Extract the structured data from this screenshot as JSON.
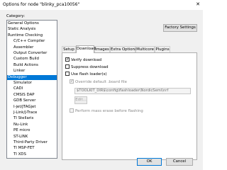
{
  "window": {
    "title": "Options for node \"blinky_pca10056\""
  },
  "category": {
    "label": "Category:",
    "items": [
      {
        "label": "General Options",
        "level": 0,
        "selected": false
      },
      {
        "label": "Static Analysis",
        "level": 0,
        "selected": false
      },
      {
        "label": "Runtime Checking",
        "level": 0,
        "selected": false
      },
      {
        "label": "C/C++ Compiler",
        "level": 1,
        "selected": false
      },
      {
        "label": "Assembler",
        "level": 1,
        "selected": false
      },
      {
        "label": "Output Converter",
        "level": 1,
        "selected": false
      },
      {
        "label": "Custom Build",
        "level": 1,
        "selected": false
      },
      {
        "label": "Build Actions",
        "level": 1,
        "selected": false
      },
      {
        "label": "Linker",
        "level": 1,
        "selected": false
      },
      {
        "label": "Debugger",
        "level": 0,
        "selected": true
      },
      {
        "label": "Simulator",
        "level": 1,
        "selected": false
      },
      {
        "label": "CADI",
        "level": 1,
        "selected": false
      },
      {
        "label": "CMSIS DAP",
        "level": 1,
        "selected": false
      },
      {
        "label": "GDB Server",
        "level": 1,
        "selected": false
      },
      {
        "label": "I-jet/JTAGjet",
        "level": 1,
        "selected": false
      },
      {
        "label": "J-Link/J-Trace",
        "level": 1,
        "selected": false
      },
      {
        "label": "TI Stellaris",
        "level": 1,
        "selected": false
      },
      {
        "label": "Nu-Link",
        "level": 1,
        "selected": false
      },
      {
        "label": "PE micro",
        "level": 1,
        "selected": false
      },
      {
        "label": "ST-LINK",
        "level": 1,
        "selected": false
      },
      {
        "label": "Third-Party Driver",
        "level": 1,
        "selected": false
      },
      {
        "label": "TI MSP-FET",
        "level": 1,
        "selected": false
      },
      {
        "label": "TI XDS",
        "level": 1,
        "selected": false
      }
    ]
  },
  "buttons": {
    "factory_settings": "Factory Settings",
    "ok": "OK",
    "cancel": "Cancel",
    "edit": "Edit..."
  },
  "tabs": [
    {
      "label": "Setup",
      "active": false
    },
    {
      "label": "Download",
      "active": true
    },
    {
      "label": "Images",
      "active": false
    },
    {
      "label": "Extra Options",
      "active": false
    },
    {
      "label": "Multicore",
      "active": false
    },
    {
      "label": "Plugins",
      "active": false
    }
  ],
  "download": {
    "verify_download": {
      "label": "Verify download",
      "checked": true,
      "enabled": true
    },
    "suppress_download": {
      "label": "Suppress download",
      "checked": false,
      "enabled": true
    },
    "use_flash_loaders": {
      "label": "Use flash loader(s)",
      "checked": false,
      "enabled": true
    },
    "override_board_file": {
      "label": "Override default .board file",
      "checked": true,
      "enabled": false
    },
    "board_file_path": "$TOOLKIT_DIR$\\config\\flashloader\\NordicSemi\\nrf",
    "perform_mass_erase": {
      "label": "Perform mass erase before flashing",
      "checked": false,
      "enabled": false
    }
  },
  "icons": {
    "close": "close-icon",
    "check": "checkmark-icon"
  },
  "colors": {
    "selection": "#0078d7",
    "dialog_bg": "#f0f0f0",
    "panel_bg": "#ffffff"
  }
}
